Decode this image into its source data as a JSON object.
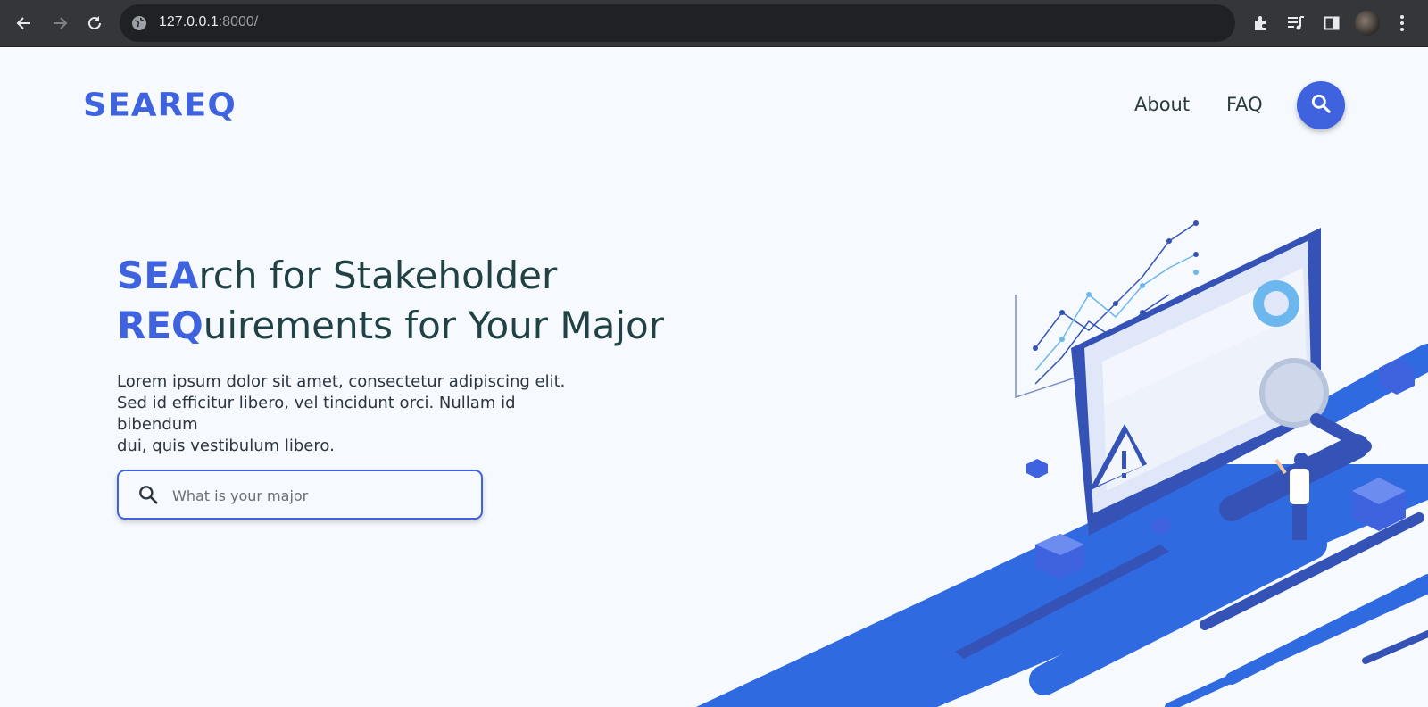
{
  "browser": {
    "url_host": "127.0.0.1",
    "url_port": ":8000/",
    "icons": [
      "back-arrow-icon",
      "forward-arrow-icon",
      "reload-icon",
      "globe-icon",
      "extensions-icon",
      "media-controls-icon",
      "side-panel-icon",
      "profile-avatar",
      "more-menu-icon"
    ]
  },
  "header": {
    "logo": "SEAREQ",
    "nav": {
      "about": "About",
      "faq": "FAQ"
    },
    "search_icon": "search-icon"
  },
  "hero": {
    "line1_highlight": "SEA",
    "line1_rest": "rch for Stakeholder",
    "line2_highlight": "REQ",
    "line2_rest": "uirements for Your Major",
    "description_line1": "Lorem ipsum dolor sit amet, consectetur adipiscing elit.",
    "description_line2": "Sed id efficitur libero, vel tincidunt orci. Nullam id bibendum",
    "description_line3": "dui, quis vestibulum libero."
  },
  "search": {
    "placeholder": "What is your major",
    "value": ""
  },
  "colors": {
    "brand": "#3f63df",
    "text_dark": "#214244",
    "page_bg": "#f6f9fe"
  }
}
